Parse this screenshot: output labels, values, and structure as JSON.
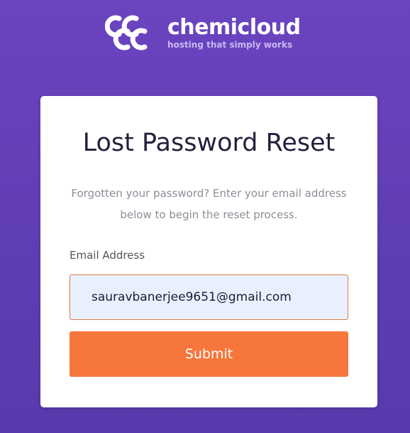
{
  "brand": {
    "name": "chemicloud",
    "tagline": "hosting that simply works",
    "logo_icon": "chemicloud-logo-icon",
    "color": "#ffffff"
  },
  "card": {
    "title": "Lost Password Reset",
    "description": "Forgotten your password? Enter your email address below to begin the reset process."
  },
  "form": {
    "email_label": "Email Address",
    "email_value": "sauravbanerjee9651@gmail.com",
    "submit_label": "Submit"
  },
  "colors": {
    "background": "#643fba",
    "accent": "#f6763c",
    "input_fill": "#e8f0fd",
    "input_border": "#e0794a"
  }
}
